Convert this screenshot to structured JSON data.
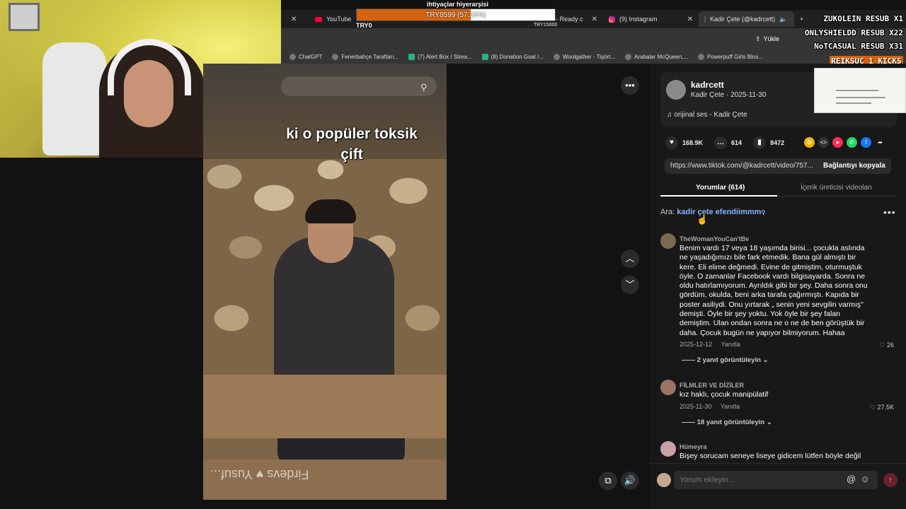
{
  "overlay": {
    "hierarchy_title": "ihtiyaçlar hiyerarşisi",
    "goal_text": "TRY8599 (57.33%)",
    "goal_progress": 0.5733,
    "goal_min": "TRY0",
    "goal_max": "TRY15000",
    "sub_lines": [
      "ZUKOLEIN RESUB X1",
      "ONLYSHIELDD RESUB X22",
      "NoTCASUAL RESUB X31"
    ],
    "kicks_label": "REIKSUC 1 KICKS",
    "accent_color": "#d4620e"
  },
  "browser": {
    "tabs": [
      {
        "label": "YouTube",
        "icon": "youtube-icon"
      },
      {
        "label": "dler - Ready c",
        "icon": ""
      },
      {
        "label": "(9) Instagram",
        "icon": "instagram-icon"
      },
      {
        "label": "Kadir Çete (@kadrcett)",
        "icon": "tiktok-icon",
        "active": true
      }
    ],
    "upload_label": "Yükle",
    "bookmarks": [
      "ChatGPT",
      "Fenerbahçe Taraftarı...",
      "(7) Alert Box / Strea...",
      "(8) Donation Goal /...",
      "Woolgather - Tişört...",
      "Arabalar McQueen,...",
      "Powerpuff Girls Blos..."
    ]
  },
  "video": {
    "caption_line1": "ki o popüler toksik",
    "caption_line2": "çift",
    "bench_text": "Firdevs ♥ Yusuf..."
  },
  "post": {
    "username": "kadrcett",
    "subline": "Kadir Çete · 2025-11-30",
    "music": "orijinal ses - Kadir Çete",
    "likes": "168.9K",
    "comments": "614",
    "saves": "8472",
    "link": "https://www.tiktok.com/@kadrcett/video/757...",
    "copy_label": "Bağlantıyı kopyala"
  },
  "tabs": {
    "comments_tab": "Yorumlar (614)",
    "creator_tab": "İçerik üreticisi videoları"
  },
  "search": {
    "prefix": "Ara:",
    "term": "kadir çete efendiimmm"
  },
  "comments": [
    {
      "user": "TheWomanYouCan'tBe",
      "text": "Benim vardı 17 veya 18 yaşımda birisi... çocukla aslında ne yaşadığımızı bile fark etmedik. Bana gül almıştı bir kere. Eli elime değmedi. Evine de gitmiştim, oturmuştuk öyle. O zamanlar Facebook vardı bilgisayarda. Sonra ne oldu hatırlamıyorum. Ayrıldık gibi bir şey. Daha sonra onu gördüm, okulda, beni arka tarafa çağırmıştı. Kapıda bir poster asiliydi. Onu yırtarak „ senin yeni sevgilin varmış\" demişti. Öyle bir şey yoktu. Yok öyle bir şey falan demiştim. Ulan ondan sonra ne o ne de ben görüştük bir daha. Çocuk bugün ne yapıyor bilmiyorum. Hahaa",
      "date": "2025-12-12",
      "reply": "Yanıtla",
      "likes": "26",
      "replies": "2 yanıt görüntüleyin"
    },
    {
      "user": "FİLMLER VE DİZİLER",
      "text": "kız haklı, çocuk manipülatif",
      "date": "2025-11-30",
      "reply": "Yanıtla",
      "likes": "27.5K",
      "replies": "18 yanıt görüntüleyin"
    },
    {
      "user": "Hümeyra",
      "text": "Bişey sorucam seneye liseye gidicem lütfen böyle değil"
    }
  ],
  "footer": {
    "placeholder": "Yorum ekleyin..."
  }
}
